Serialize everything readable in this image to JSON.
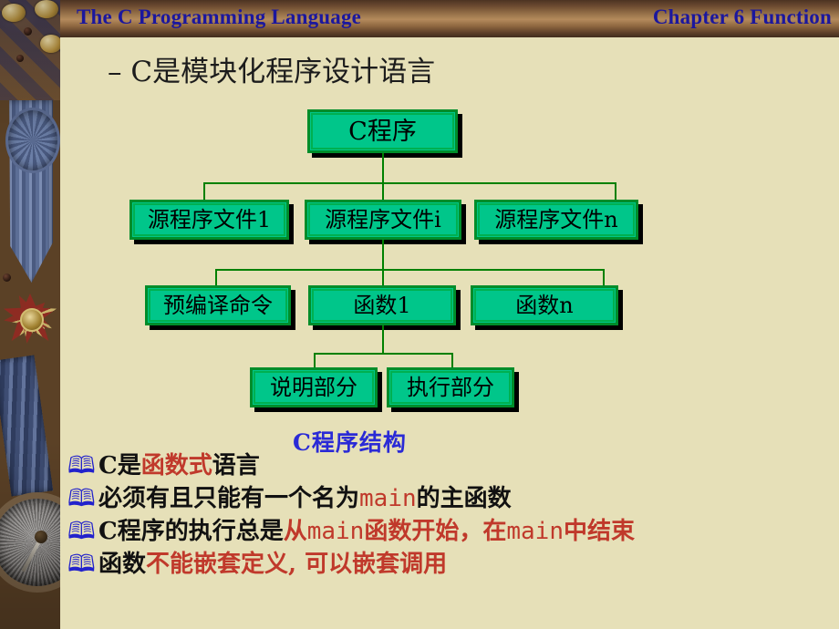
{
  "header": {
    "title": "The C Programming Language",
    "chapter": "Chapter 6    Function",
    "text_color": "#1b179e",
    "banner_color": "#a07a4f"
  },
  "sidebar": {
    "decoration": "medal-ribbon-compass-photo",
    "icons": [
      "coin-icon",
      "rosette-icon",
      "medal-cross-icon",
      "compass-icon"
    ]
  },
  "slide": {
    "background_color": "#e6e0b8",
    "subtitle": "– C是模块化程序设计语言"
  },
  "diagram": {
    "caption": "C程序结构",
    "caption_color": "#2a2ad6",
    "node_fill": "#00c68a",
    "node_border": "#008d2a",
    "connector_color": "#008000",
    "nodes": {
      "root": "C程序",
      "files": [
        "源程序文件1",
        "源程序文件i",
        "源程序文件n"
      ],
      "parts": [
        "预编译命令",
        "函数1",
        "函数n"
      ],
      "sections": [
        "说明部分",
        "执行部分"
      ]
    }
  },
  "bullets": {
    "icon": "open-book-icon",
    "icon_glyph": "🕮",
    "icon_color": "#2222cc",
    "highlight_color": "#c0392b",
    "items": [
      {
        "id": "bullet-1",
        "parts": [
          {
            "text": "C是",
            "style": "normal"
          },
          {
            "text": "函数式",
            "style": "highlight"
          },
          {
            "text": "语言",
            "style": "normal"
          }
        ]
      },
      {
        "id": "bullet-2",
        "parts": [
          {
            "text": "必须有且只能有一个名为",
            "style": "normal"
          },
          {
            "text": "main",
            "style": "highlight-mono"
          },
          {
            "text": "的主函数",
            "style": "normal"
          }
        ]
      },
      {
        "id": "bullet-3",
        "parts": [
          {
            "text": "C程序的执行总是",
            "style": "normal"
          },
          {
            "text": "从",
            "style": "highlight"
          },
          {
            "text": "main",
            "style": "highlight-mono"
          },
          {
            "text": "函数开始，在",
            "style": "highlight"
          },
          {
            "text": "main",
            "style": "highlight-mono"
          },
          {
            "text": "中结束",
            "style": "highlight"
          }
        ]
      },
      {
        "id": "bullet-4",
        "parts": [
          {
            "text": "函数",
            "style": "normal"
          },
          {
            "text": "不能嵌套定义, 可以嵌套调用",
            "style": "highlight"
          }
        ]
      }
    ]
  }
}
